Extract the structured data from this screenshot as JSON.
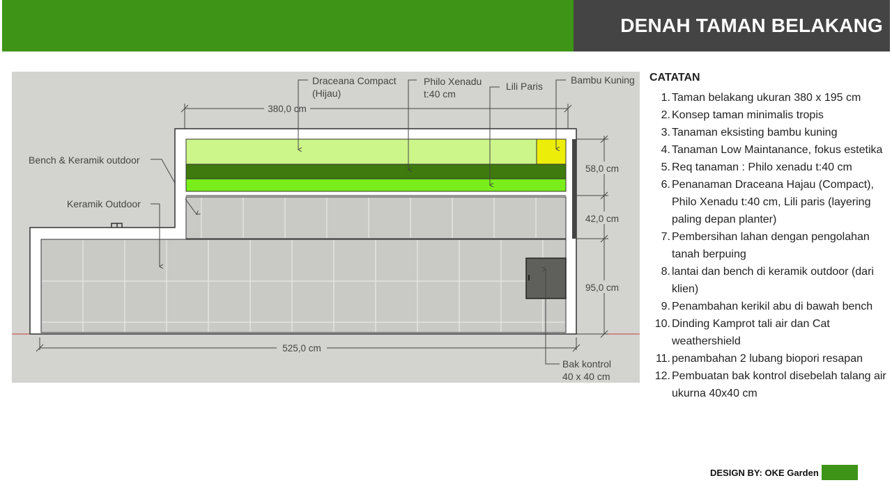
{
  "header": {
    "title": "DENAH TAMAN BELAKANG",
    "accent_color": "#3d9416",
    "dark_color": "#444444"
  },
  "plan": {
    "labels": {
      "draceana_1": "Draceana Compact",
      "draceana_2": "(Hijau)",
      "philo_1": "Philo Xenadu",
      "philo_2": "t:40 cm",
      "lili": "Lili Paris",
      "bambu": "Bambu Kuning",
      "bench": "Bench & Keramik outdoor",
      "keramik": "Keramik Outdoor",
      "bak_1": "Bak kontrol",
      "bak_2": "40 x 40 cm"
    },
    "dimensions": {
      "top_width": "380,0 cm",
      "bottom_width": "525,0 cm",
      "planter": "58,0 cm",
      "bench": "42,0 cm",
      "floor": "95,0 cm"
    },
    "colors": {
      "background": "#d3d3cf",
      "tile": "#c9c9c6",
      "draceana": "#ccf58a",
      "philo": "#3e7a0d",
      "lili": "#79ee1b",
      "bambu": "#eded0a",
      "bak": "#5f5f5c"
    }
  },
  "notes": {
    "title": "CATATAN",
    "items": [
      {
        "num": "1.",
        "text": "Taman belakang ukuran 380 x 195 cm"
      },
      {
        "num": "2.",
        "text": "Konsep taman minimalis tropis"
      },
      {
        "num": "3.",
        "text": "Tanaman eksisting bambu kuning"
      },
      {
        "num": "4.",
        "text": "Tanaman Low Maintanance, fokus estetika"
      },
      {
        "num": "5.",
        "text": "Req tanaman : Philo xenadu t:40 cm"
      },
      {
        "num": "6.",
        "text": "Penanaman Draceana Hajau (Compact), Philo Xenadu t:40 cm, Lili paris (layering paling depan planter)"
      },
      {
        "num": "7.",
        "text": "Pembersihan lahan dengan pengolahan tanah berpuing"
      },
      {
        "num": "8.",
        "text": "lantai dan bench di keramik outdoor (dari klien)"
      },
      {
        "num": "9.",
        "text": "Penambahan kerikil abu di bawah bench"
      },
      {
        "num": "10.",
        "text": "Dinding  Kamprot tali air dan Cat weathershield"
      },
      {
        "num": "11.",
        "text": "penambahan 2 lubang biopori resapan"
      },
      {
        "num": "12.",
        "text": "Pembuatan bak kontrol disebelah talang air ukurna 40x40 cm"
      }
    ]
  },
  "footer": {
    "label": "DESIGN BY: OKE Garden"
  }
}
